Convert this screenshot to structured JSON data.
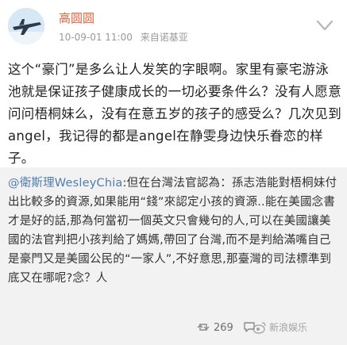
{
  "post": {
    "user_name": "高圆圆",
    "timestamp": "10-09-01 11:00",
    "source": "来自诺基亚",
    "text": "这个“豪门”是多么让人发笑的字眼啊。家里有豪宅游泳池就是保证孩子健康成长的一切必要条件么？没有人愿意问问梧桐妹么，没有在意五岁的孩子的感受么？几次见到angel，我记得的都是angel在静雯身边快乐眷恋的样子。"
  },
  "repost": {
    "mention": "@衛斯理WesleyChia",
    "text": ":但在台灣法官認為：孫志浩能對梧桐妹付出比較多的資源,如果能用“錢”來認定小孩的資源..能在美國念書才是好的話,那為何當初一個英文只會幾句的人,可以在美國讓美國的法官判把小孩判給了媽媽,帶回了台灣,而不是判給滿嘴自己是豪門又是美國公民的“一家人”,不好意思,那臺灣的司法標準到底又在哪呢?念？人"
  },
  "stats": {
    "reposts": "269",
    "comments": ""
  },
  "watermark": "新浪娱乐",
  "icons": {
    "avatar": "airplane-avatar",
    "more": "chevron-down-icon",
    "repost": "repost-icon",
    "comment": "comment-icon",
    "watermark": "weibo-logo"
  },
  "colors": {
    "name": "#e0633c",
    "mention": "#507daf",
    "repost_bg": "#f2f2f2"
  }
}
